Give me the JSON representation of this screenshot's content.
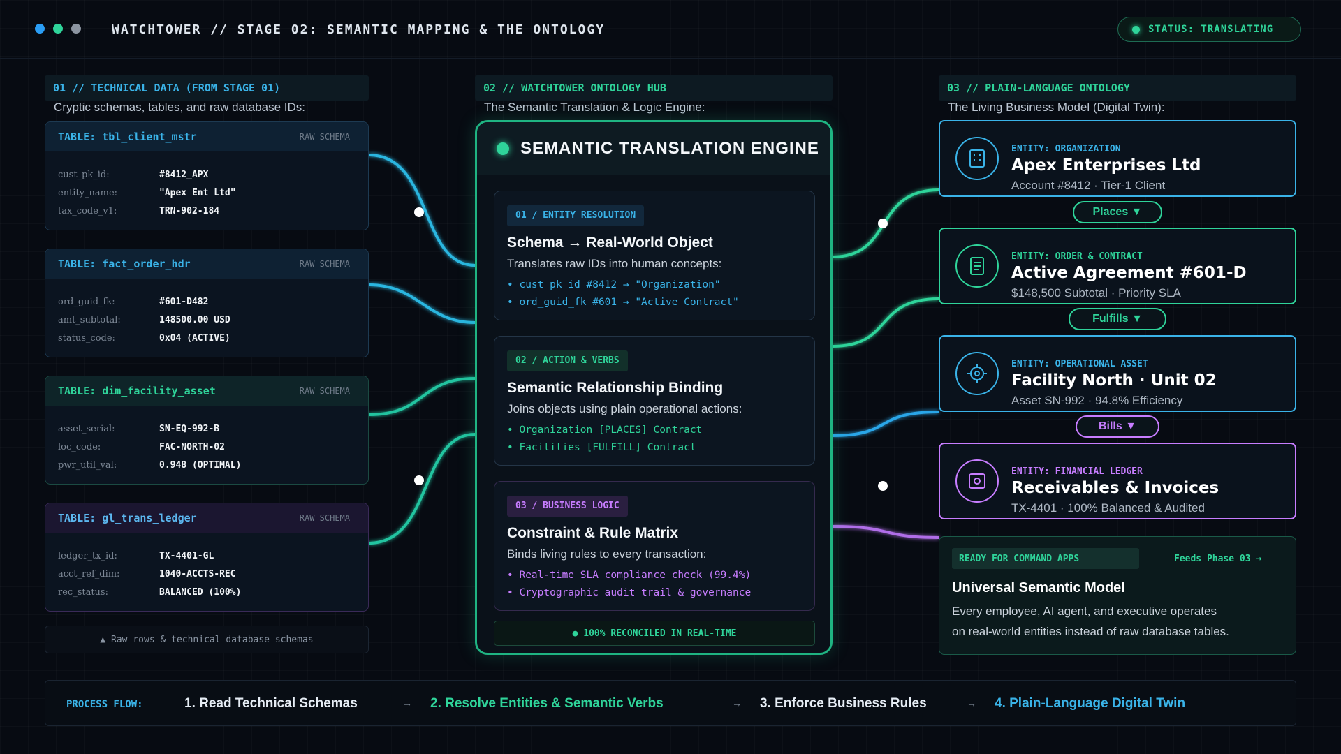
{
  "header": {
    "title": "WATCHTOWER // STAGE 02: SEMANTIC MAPPING & THE ONTOLOGY",
    "status": "STATUS: TRANSLATING",
    "window_dots": [
      "#2a9df4",
      "#2fd49a",
      "#8b94a0"
    ]
  },
  "columns": {
    "left": {
      "heading": "01 // TECHNICAL DATA (FROM STAGE 01)",
      "subtitle": "Cryptic schemas, tables, and raw database IDs:"
    },
    "center": {
      "heading": "02 // WATCHTOWER ONTOLOGY HUB",
      "subtitle": "The Semantic Translation & Logic Engine:"
    },
    "right": {
      "heading": "03 // PLAIN-LANGUAGE ONTOLOGY",
      "subtitle": "The Living Business Model (Digital Twin):"
    }
  },
  "tables": [
    {
      "title": "TABLE: tbl_client_mstr",
      "tag": "RAW SCHEMA",
      "rows": [
        {
          "k": "cust_pk_id:",
          "v": "#8412_APX"
        },
        {
          "k": "entity_name:",
          "v": "\"Apex Ent Ltd\""
        },
        {
          "k": "tax_code_v1:",
          "v": "TRN-902-184"
        }
      ]
    },
    {
      "title": "TABLE: fact_order_hdr",
      "tag": "RAW SCHEMA",
      "rows": [
        {
          "k": "ord_guid_fk:",
          "v": "#601-D482"
        },
        {
          "k": "amt_subtotal:",
          "v": "148500.00 USD"
        },
        {
          "k": "status_code:",
          "v": "0x04 (ACTIVE)"
        }
      ]
    },
    {
      "title": "TABLE: dim_facility_asset",
      "tag": "RAW SCHEMA",
      "rows": [
        {
          "k": "asset_serial:",
          "v": "SN-EQ-992-B"
        },
        {
          "k": "loc_code:",
          "v": "FAC-NORTH-02"
        },
        {
          "k": "pwr_util_val:",
          "v": "0.948 (OPTIMAL)"
        }
      ]
    },
    {
      "title": "TABLE: gl_trans_ledger",
      "tag": "RAW SCHEMA",
      "rows": [
        {
          "k": "ledger_tx_id:",
          "v": "TX-4401-GL"
        },
        {
          "k": "acct_ref_dim:",
          "v": "1040-ACCTS-REC"
        },
        {
          "k": "rec_status:",
          "v": "BALANCED (100%)"
        }
      ]
    }
  ],
  "raw_note": "▲ Raw rows & technical database schemas",
  "engine": {
    "title": "SEMANTIC TRANSLATION ENGINE",
    "cards": [
      {
        "tag": "01 / ENTITY RESOLUTION",
        "title": "Schema → Real-World Object",
        "desc": "Translates raw IDs into human concepts:",
        "items": [
          "• cust_pk_id #8412 → \"Organization\"",
          "• ord_guid_fk #601 → \"Active Contract\""
        ]
      },
      {
        "tag": "02 / ACTION & VERBS",
        "title": "Semantic Relationship Binding",
        "desc": "Joins objects using plain operational actions:",
        "items": [
          "• Organization [PLACES] Contract",
          "• Facilities [FULFILL] Contract"
        ]
      },
      {
        "tag": "03 / BUSINESS LOGIC",
        "title": "Constraint & Rule Matrix",
        "desc": "Binds living rules to every transaction:",
        "items": [
          "• Real-time SLA compliance check (99.4%)",
          "• Cryptographic audit trail & governance"
        ]
      }
    ],
    "reconciled": "● 100% RECONCILED IN REAL-TIME"
  },
  "entities": [
    {
      "kind": "ENTITY: ORGANIZATION",
      "name": "Apex Enterprises Ltd",
      "meta": "Account #8412 · Tier-1 Client",
      "icon": "building-icon",
      "color": "#3ab3e8"
    },
    {
      "kind": "ENTITY: ORDER & CONTRACT",
      "name": "Active Agreement #601-D",
      "meta": "$148,500 Subtotal · Priority SLA",
      "icon": "document-icon",
      "color": "#2fd49a"
    },
    {
      "kind": "ENTITY: OPERATIONAL ASSET",
      "name": "Facility North · Unit 02",
      "meta": "Asset SN-992 · 94.8% Efficiency",
      "icon": "crosshair-icon",
      "color": "#3ab3e8"
    },
    {
      "kind": "ENTITY: FINANCIAL LEDGER",
      "name": "Receivables & Invoices",
      "meta": "TX-4401 · 100% Balanced & Audited",
      "icon": "vault-icon",
      "color": "#c77dff"
    }
  ],
  "verbs": [
    "Places ▼",
    "Fulfills ▼",
    "Bills ▼"
  ],
  "usm": {
    "tag": "READY FOR COMMAND APPS",
    "feeds": "Feeds Phase 03 →",
    "title": "Universal Semantic Model",
    "desc_line1": "Every employee, AI agent, and executive operates",
    "desc_line2": "on real-world entities instead of raw database tables."
  },
  "flow": {
    "label": "PROCESS FLOW:",
    "steps": [
      "1. Read Technical Schemas",
      "2. Resolve Entities & Semantic Verbs",
      "3. Enforce Business Rules",
      "4. Plain-Language Digital Twin"
    ],
    "arrow": "→"
  },
  "colors": {
    "cyan": "#3ab3e8",
    "green": "#2fd49a",
    "purple": "#c77dff",
    "teal": "#1fb482"
  }
}
